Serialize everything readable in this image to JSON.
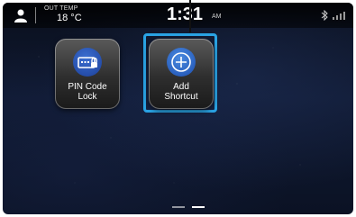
{
  "status_bar": {
    "outside_temp_label": "OUT TEMP",
    "outside_temp_value": "18 °C",
    "time": "1:31",
    "am_pm": "AM",
    "icons": [
      "user-icon",
      "bluetooth-icon",
      "signal-icon"
    ]
  },
  "shortcuts": [
    {
      "label_line1": "PIN Code",
      "label_line2": "Lock",
      "icon": "pin-lock-icon",
      "selected": false
    },
    {
      "label_line1": "Add",
      "label_line2": "Shortcut",
      "icon": "add-icon",
      "selected": true
    }
  ],
  "pagination": {
    "pages": 2,
    "current": 1
  },
  "colors": {
    "accent_highlight": "#2aa3e4",
    "icon_blue": "#2a5fc4"
  }
}
